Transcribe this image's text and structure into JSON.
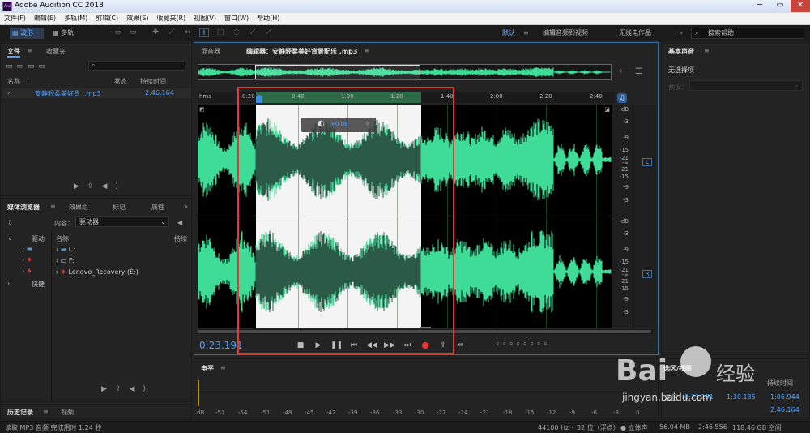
{
  "window": {
    "title": "Adobe Audition CC 2018",
    "app_icon": "Au"
  },
  "menu": [
    "文件(F)",
    "编辑(E)",
    "多轨(M)",
    "剪辑(C)",
    "效果(S)",
    "收藏夹(R)",
    "视图(V)",
    "窗口(W)",
    "帮助(H)"
  ],
  "toolbar": {
    "waveform": "波形",
    "multitrack": "多轨",
    "workspace": "默认",
    "ws2": "编辑音频到视频",
    "ws3": "无线电作品",
    "search_placeholder": "搜索帮助"
  },
  "files": {
    "tab1": "文件",
    "tab2": "收藏夹",
    "col_name": "名称",
    "col_status": "状态",
    "col_duration": "持续时间",
    "item_name": "安静轻柔美好背 ..mp3",
    "item_duration": "2:46.164"
  },
  "media": {
    "tabs": [
      "媒体浏览器",
      "效果组",
      "标记",
      "属性"
    ],
    "content_label": "内容：",
    "content_value": "驱动器",
    "tree_root": "驱动",
    "tree_quick": "快捷",
    "col_name": "名称",
    "col_duration": "持续",
    "drives": [
      "C:",
      "F:",
      "Lenovo_Recovery (E:)"
    ]
  },
  "history": {
    "tab1": "历史记录",
    "tab2": "视频"
  },
  "editor": {
    "mixer_tab": "混音器",
    "editor_tab": "编辑器：安静轻柔美好背景配乐 .mp3",
    "time_unit": "hms",
    "time_ticks": [
      "0:20",
      "0:40",
      "1:00",
      "1:20",
      "1:40",
      "2:00",
      "2:20",
      "2:40"
    ],
    "db_ticks": [
      "dB",
      "-3",
      "-9",
      "-15",
      "-21",
      "-∞",
      "-21",
      "-15",
      "-9",
      "-3"
    ],
    "channel_left": "L",
    "channel_right": "R",
    "hud_gain": "+0 dB",
    "current_time": "0:23.191"
  },
  "levels": {
    "title": "电平",
    "scale": [
      "dB",
      "-57",
      "-54",
      "-51",
      "-48",
      "-45",
      "-42",
      "-39",
      "-36",
      "-33",
      "-30",
      "-27",
      "-24",
      "-21",
      "-18",
      "-15",
      "-12",
      "-9",
      "-6",
      "-3",
      "0"
    ]
  },
  "essential": {
    "title": "基本声音",
    "no_selection": "无选择项",
    "preset_label": "预设："
  },
  "selection": {
    "title": "选区/视图",
    "col_duration": "持续时间",
    "row_label": "选区",
    "start": "0:23.191",
    "end": "1:30.135",
    "duration": "1:06.944",
    "view_duration": "2:46.164"
  },
  "status": {
    "left": "读取 MP3 音频 完成用时 1.24 秒",
    "rate": "44100 Hz • 32 位（浮点）",
    "channels": "立体声",
    "size": "56.04 MB",
    "duration": "2:46.556",
    "disk": "118.46 GB 空间"
  },
  "watermark": {
    "text1": "Bai",
    "text2": "经验",
    "url": "jingyan.baidu.com"
  },
  "colors": {
    "wave": "#3fdc98",
    "wave_dim": "#2b5a47",
    "selection_bg": "#f4f4f4",
    "accent": "#4da3ff",
    "record": "#e5322d",
    "highlight_box": "#e53935"
  }
}
